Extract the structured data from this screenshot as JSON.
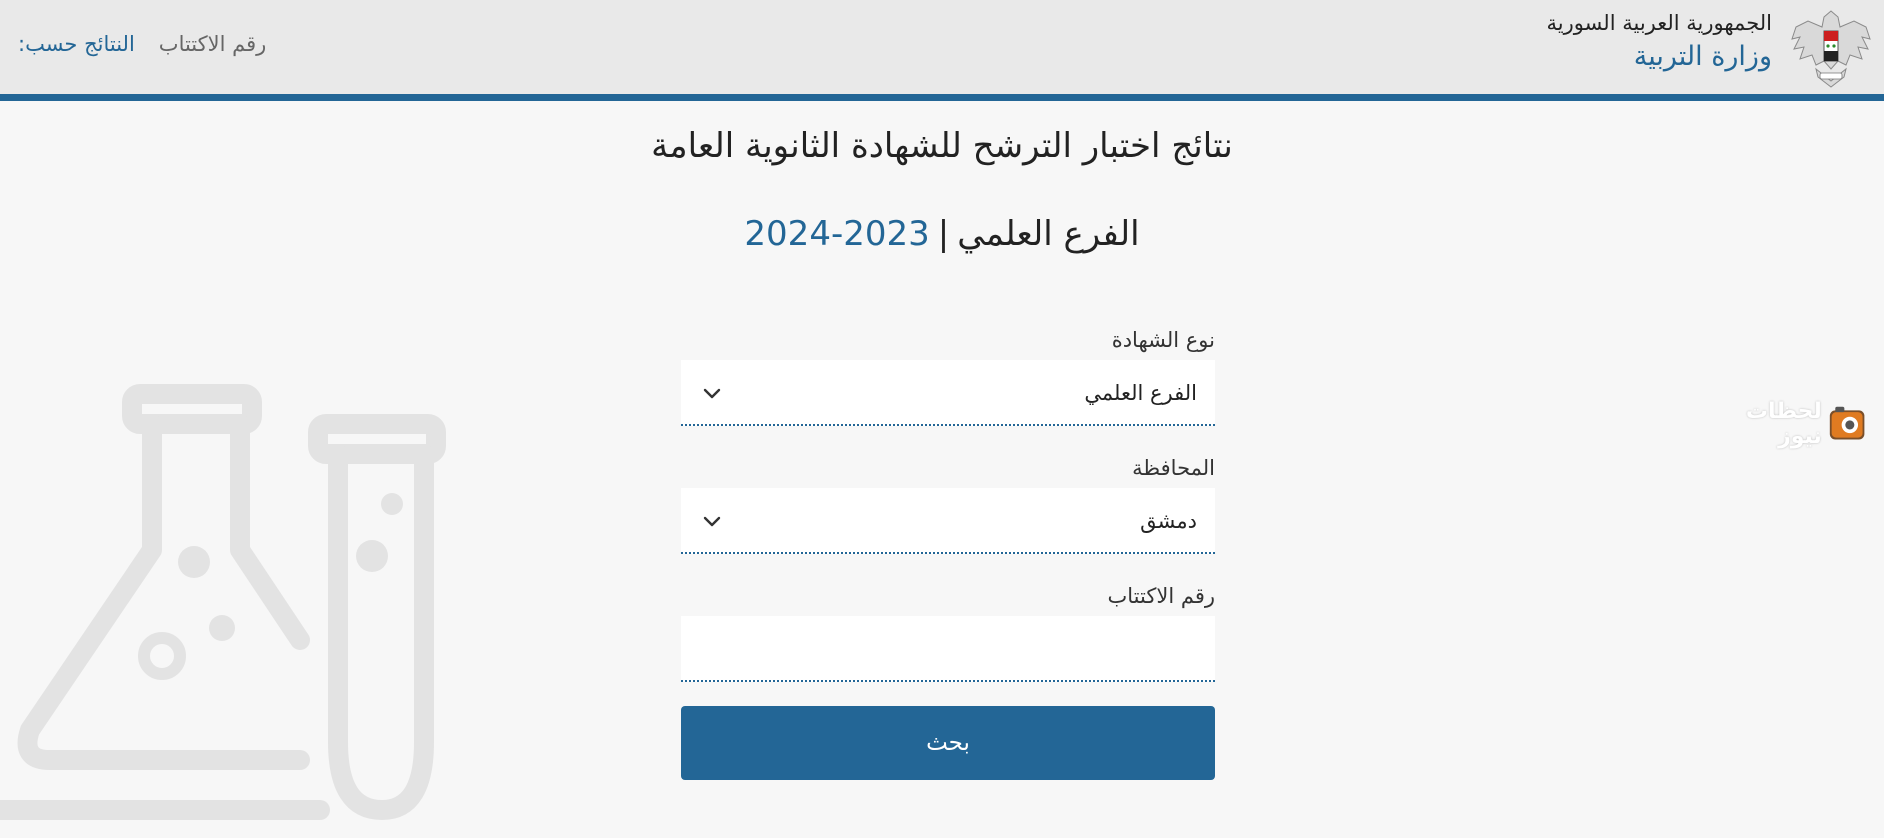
{
  "header": {
    "country": "الجمهورية العربية السورية",
    "ministry": "وزارة التربية",
    "results_by_label": "النتائج حسب:",
    "results_by_link": "رقم الاكتتاب"
  },
  "page": {
    "title": "نتائج اختبار الترشح للشهادة الثانوية العامة",
    "branch": "الفرع العلمي",
    "separator": "|",
    "year": "2023-2024"
  },
  "form": {
    "certificate_type_label": "نوع الشهادة",
    "certificate_type_value": "الفرع العلمي",
    "governorate_label": "المحافظة",
    "governorate_value": "دمشق",
    "subscription_number_label": "رقم الاكتتاب",
    "subscription_number_value": "",
    "search_button": "بحث"
  },
  "watermark": {
    "text": "لحظات نيوز"
  },
  "colors": {
    "accent": "#236696",
    "header_bg": "#e9e9e9",
    "page_bg": "#f7f7f7"
  },
  "icons": {
    "emblem": "syrian-eagle-emblem-icon",
    "select_chevron": "chevron-down-icon",
    "background_illustration": "lab-flask-icon"
  }
}
